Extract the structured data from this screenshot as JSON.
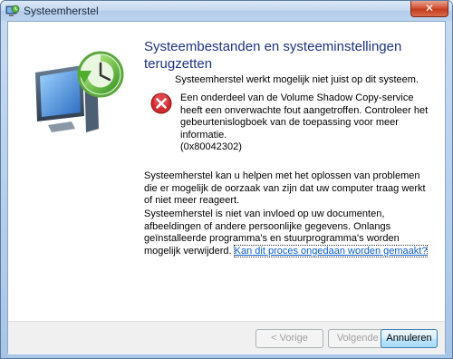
{
  "window": {
    "title": "Systeemherstel",
    "close_glyph": "✕"
  },
  "icons": {
    "app": "system-restore-icon",
    "art": "system-restore-computer-icon",
    "error": "error-icon"
  },
  "content": {
    "heading": "Systeembestanden en systeeminstellingen terugzetten",
    "intro": "Systeemherstel werkt mogelijk niet juist op dit systeem.",
    "error_message": "Een onderdeel van de Volume Shadow Copy-service heeft een onverwachte fout aangetroffen. Controleer het gebeurtenislogboek van de toepassing voor meer informatie.\n(0x80042302)",
    "paragraph1": "Systeemherstel kan u helpen met het oplossen van problemen die er mogelijk de oorzaak van zijn dat uw computer traag werkt of niet meer reageert.",
    "paragraph2": "Systeemherstel is niet van invloed op uw documenten, afbeeldingen of andere persoonlijke gegevens. Onlangs geïnstalleerde programma's en stuurprogramma's worden mogelijk verwijderd.",
    "link": "Kan dit proces ongedaan worden gemaakt?"
  },
  "buttons": {
    "prev": "< Vorige",
    "next": "Volgende >",
    "cancel": "Annuleren"
  },
  "colors": {
    "heading": "#1e3287",
    "link": "#0b5fcf",
    "error": "#c8202a"
  }
}
